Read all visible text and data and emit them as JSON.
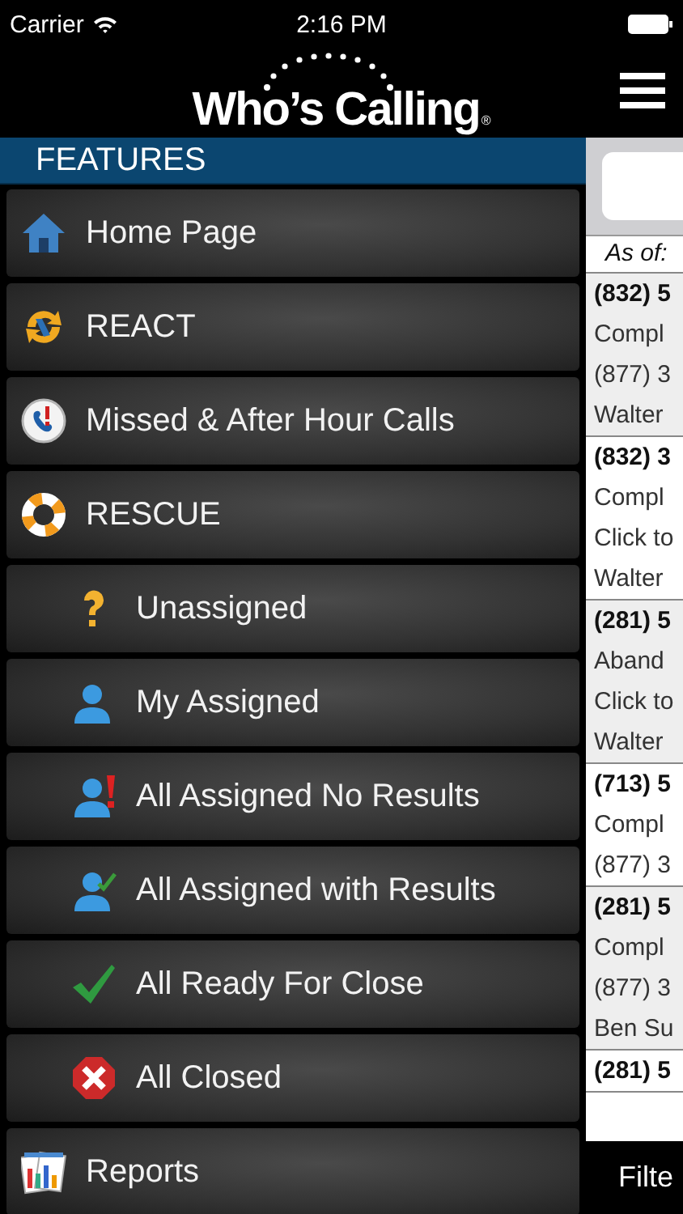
{
  "status_bar": {
    "carrier": "Carrier",
    "time": "2:16 PM"
  },
  "header": {
    "logo": "Who’s Calling",
    "logo_mark": "®"
  },
  "sidebar": {
    "title": "FEATURES",
    "items": [
      {
        "label": "Home Page"
      },
      {
        "label": "REACT"
      },
      {
        "label": "Missed & After Hour Calls"
      },
      {
        "label": "RESCUE",
        "children": [
          {
            "label": "Unassigned"
          },
          {
            "label": "My Assigned"
          },
          {
            "label": "All Assigned No Results"
          },
          {
            "label": "All Assigned with Results"
          },
          {
            "label": "All Ready For Close"
          },
          {
            "label": "All Closed"
          }
        ]
      },
      {
        "label": "Reports"
      }
    ]
  },
  "calls": {
    "as_of": "As of:",
    "groups": [
      {
        "lines": [
          "(832) 5",
          "Compl",
          "(877) 3",
          "Walter"
        ]
      },
      {
        "lines": [
          "(832) 3",
          "Compl",
          "Click to",
          "Walter"
        ]
      },
      {
        "lines": [
          "(281) 5",
          "Aband",
          "Click to",
          "Walter"
        ]
      },
      {
        "lines": [
          "(713) 5",
          "Compl",
          "(877) 3"
        ]
      },
      {
        "lines": [
          "(281) 5",
          "Compl",
          "(877) 3",
          "Ben Su"
        ]
      },
      {
        "lines": [
          "(281) 5"
        ]
      }
    ],
    "filter": "Filte"
  }
}
